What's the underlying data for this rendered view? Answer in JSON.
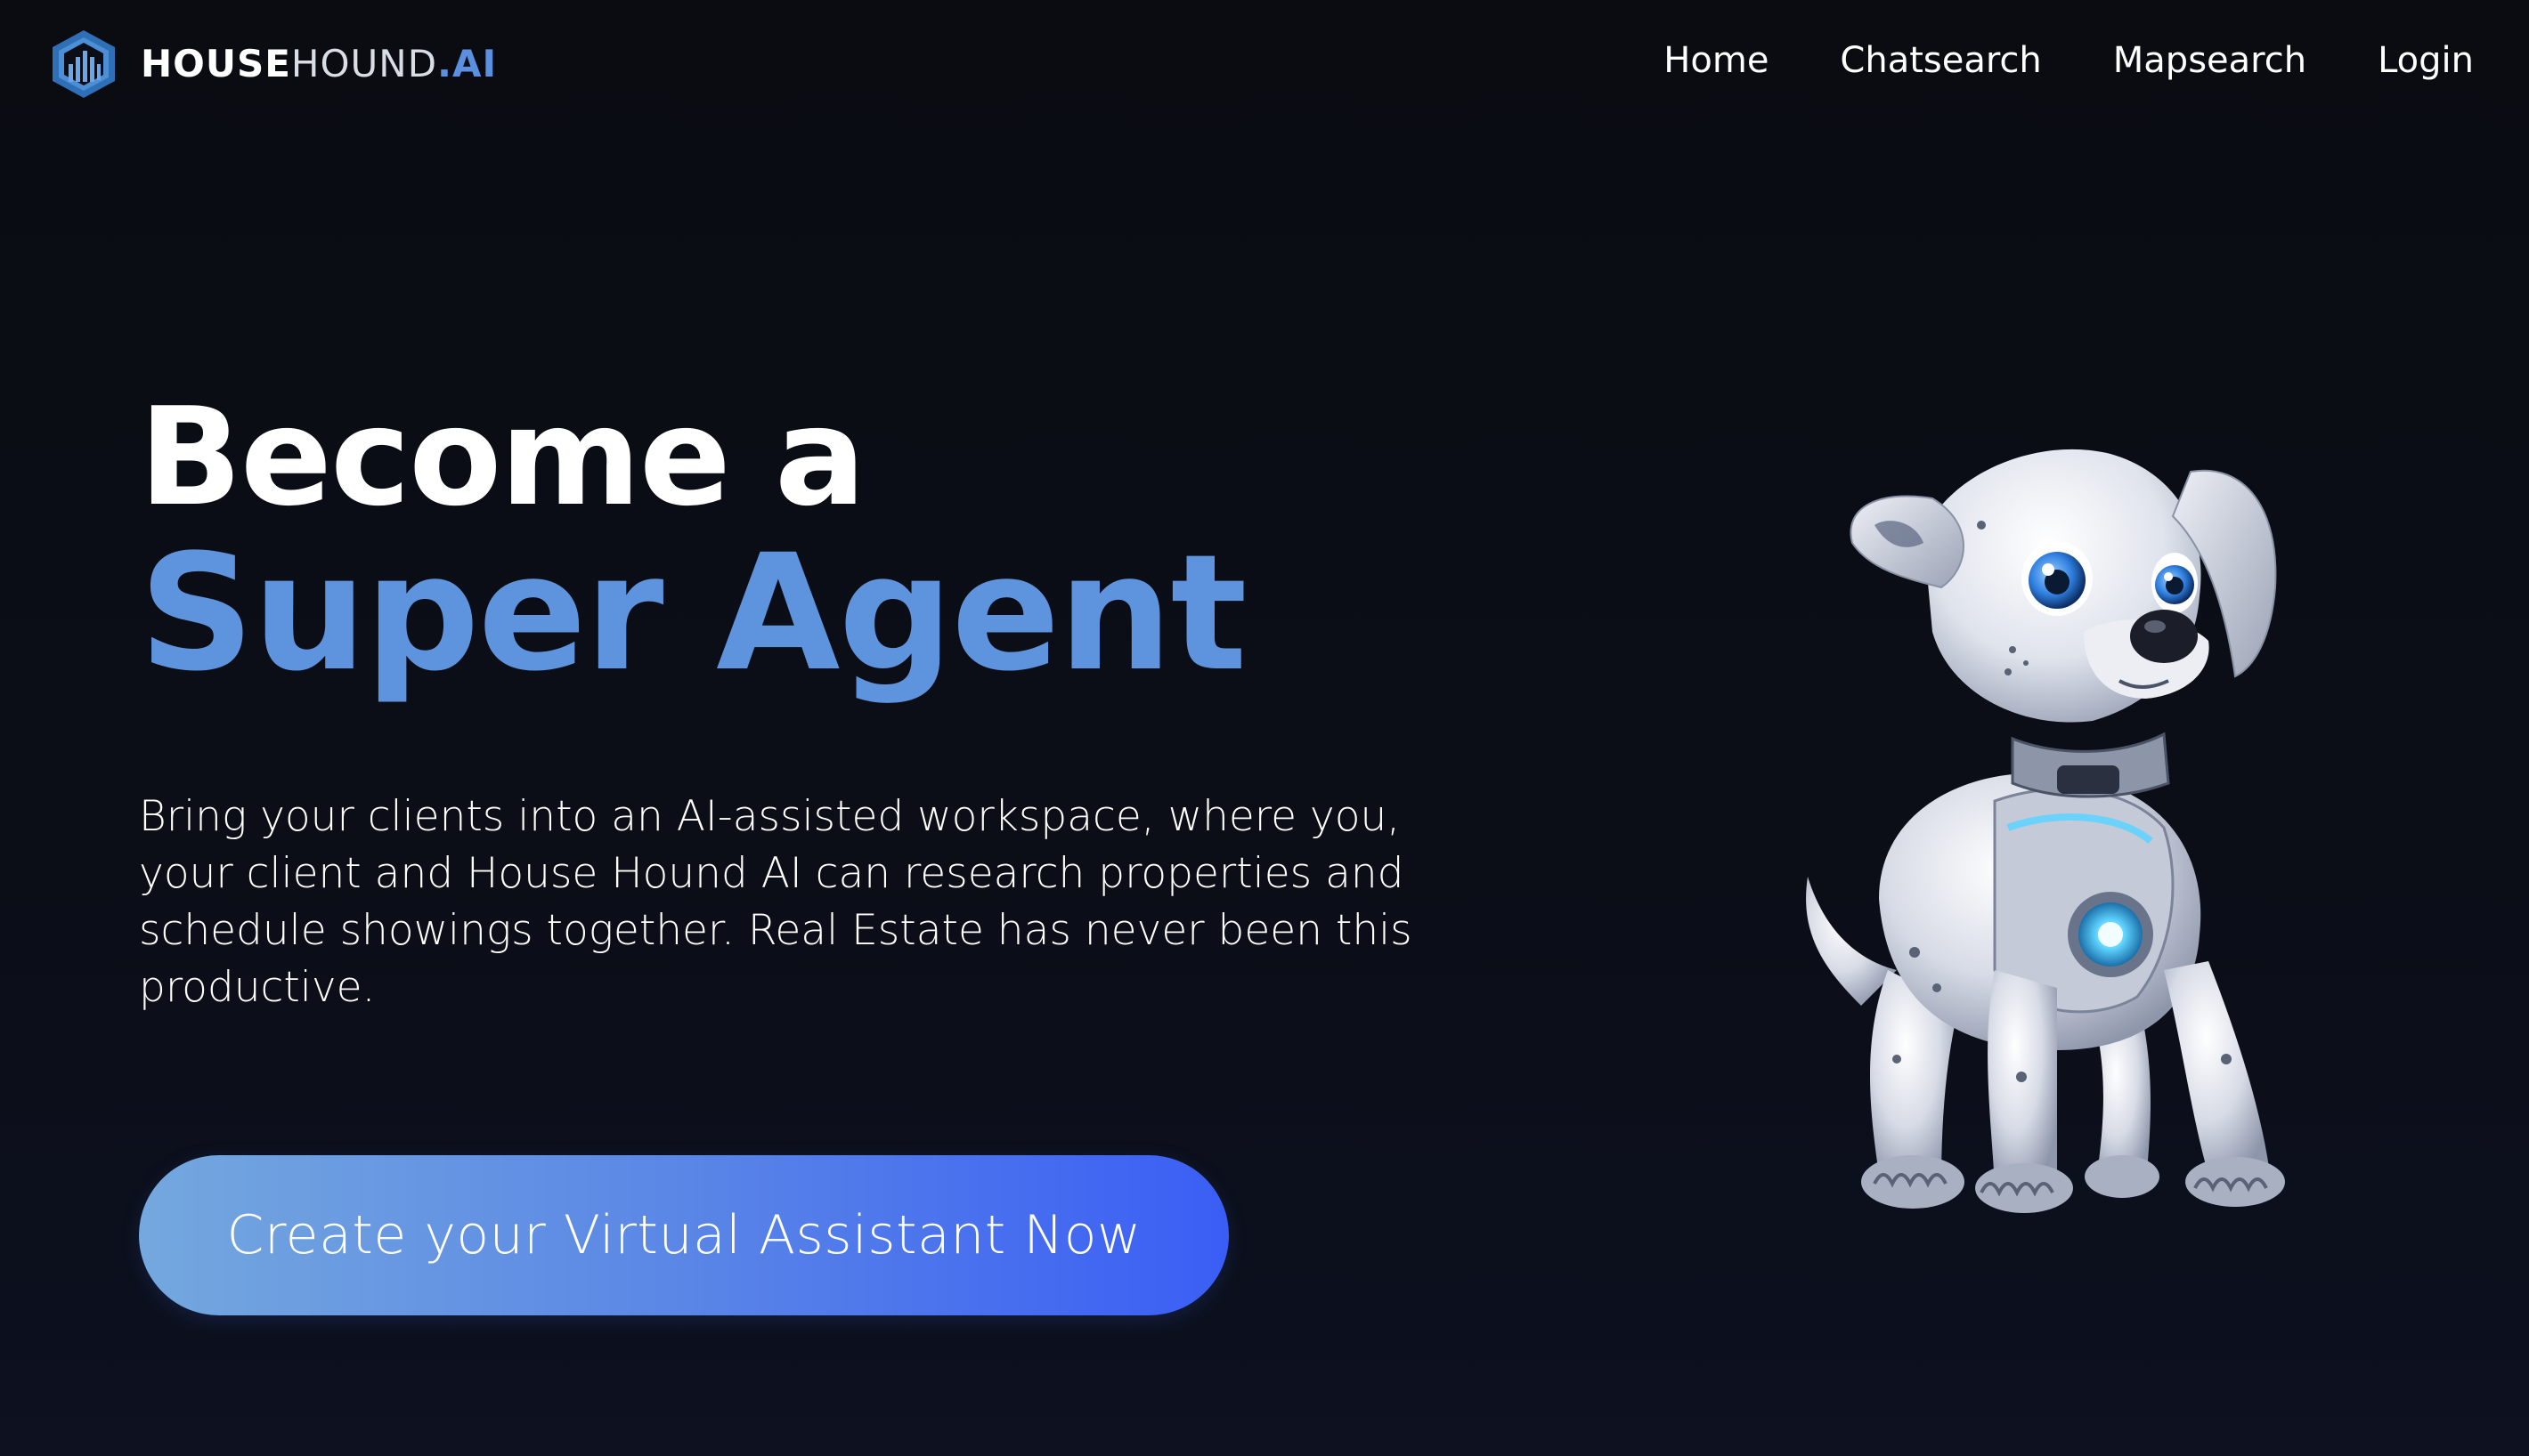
{
  "brand": {
    "name_part1": "HOUSE",
    "name_part2": "HOUND",
    "name_part3": ".AI",
    "logo_icon": "house-hound-logo-icon"
  },
  "nav": {
    "items": [
      {
        "label": "Home"
      },
      {
        "label": "Chatsearch"
      },
      {
        "label": "Mapsearch"
      },
      {
        "label": "Login"
      }
    ]
  },
  "hero": {
    "title_line1": "Become a",
    "title_line2": "Super Agent",
    "description": "Bring your clients into an AI-assisted workspace, where you, your client and House Hound AI can research properties and schedule showings together. Real Estate has never been this productive.",
    "cta_label": "Create your Virtual Assistant Now"
  },
  "mascot": {
    "icon": "robot-dog-mascot"
  },
  "colors": {
    "background": "#0b0e17",
    "accent": "#5e93de",
    "cta_start": "#74a8de",
    "cta_end": "#3a5ef5"
  }
}
